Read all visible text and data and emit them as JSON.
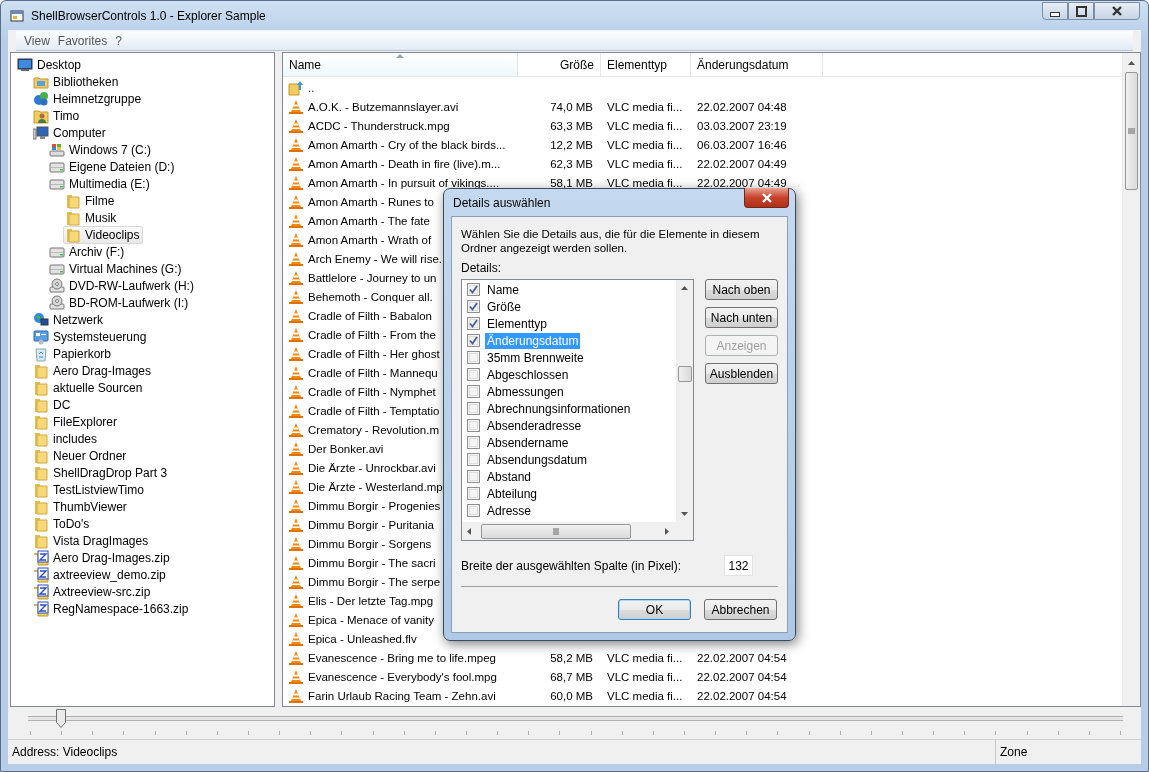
{
  "window": {
    "title": "ShellBrowserControls 1.0 - Explorer Sample"
  },
  "menu": [
    "View",
    "Favorites",
    "?"
  ],
  "tree": {
    "items": [
      {
        "label": "Desktop",
        "kind": "desktop",
        "selected": false,
        "children": [
          {
            "label": "Bibliotheken",
            "kind": "library",
            "selected": false
          },
          {
            "label": "Heimnetzgruppe",
            "kind": "homegroup",
            "selected": false
          },
          {
            "label": "Timo",
            "kind": "user",
            "selected": false
          },
          {
            "label": "Computer",
            "kind": "computer",
            "selected": false,
            "children": [
              {
                "label": "Windows 7 (C:)",
                "kind": "system-drive",
                "selected": false
              },
              {
                "label": "Eigene Dateien (D:)",
                "kind": "drive",
                "selected": false
              },
              {
                "label": "Multimedia (E:)",
                "kind": "drive",
                "selected": false,
                "children": [
                  {
                    "label": "Filme",
                    "kind": "folder",
                    "selected": false
                  },
                  {
                    "label": "Musik",
                    "kind": "folder",
                    "selected": false
                  },
                  {
                    "label": "Videoclips",
                    "kind": "folder",
                    "selected": true
                  }
                ]
              },
              {
                "label": "Archiv (F:)",
                "kind": "drive",
                "selected": false
              },
              {
                "label": "Virtual Machines (G:)",
                "kind": "drive",
                "selected": false
              },
              {
                "label": "DVD-RW-Laufwerk (H:)",
                "kind": "optical",
                "selected": false
              },
              {
                "label": "BD-ROM-Laufwerk (I:)",
                "kind": "optical",
                "selected": false
              }
            ]
          },
          {
            "label": "Netzwerk",
            "kind": "network",
            "selected": false
          },
          {
            "label": "Systemsteuerung",
            "kind": "control-panel",
            "selected": false
          },
          {
            "label": "Papierkorb",
            "kind": "recycle",
            "selected": false
          },
          {
            "label": "Aero Drag-Images",
            "kind": "folder",
            "selected": false
          },
          {
            "label": "aktuelle Sourcen",
            "kind": "folder",
            "selected": false
          },
          {
            "label": "DC",
            "kind": "folder",
            "selected": false
          },
          {
            "label": "FileExplorer",
            "kind": "folder",
            "selected": false
          },
          {
            "label": "includes",
            "kind": "folder",
            "selected": false
          },
          {
            "label": "Neuer Ordner",
            "kind": "folder",
            "selected": false
          },
          {
            "label": "ShellDragDrop Part 3",
            "kind": "folder",
            "selected": false
          },
          {
            "label": "TestListviewTimo",
            "kind": "folder",
            "selected": false
          },
          {
            "label": "ThumbViewer",
            "kind": "folder",
            "selected": false
          },
          {
            "label": "ToDo's",
            "kind": "folder",
            "selected": false
          },
          {
            "label": "Vista DragImages",
            "kind": "folder",
            "selected": false
          },
          {
            "label": "Aero Drag-Images.zip",
            "kind": "zip",
            "selected": false
          },
          {
            "label": "axtreeview_demo.zip",
            "kind": "zip",
            "selected": false
          },
          {
            "label": "Axtreeview-src.zip",
            "kind": "zip",
            "selected": false
          },
          {
            "label": "RegNamespace-1663.zip",
            "kind": "zip",
            "selected": false
          }
        ]
      }
    ]
  },
  "file_list": {
    "columns": [
      {
        "label": "Name",
        "sorted": true
      },
      {
        "label": "Größe",
        "sorted": false
      },
      {
        "label": "Elementtyp",
        "sorted": false
      },
      {
        "label": "Änderungsdatum",
        "sorted": false
      }
    ],
    "rows": [
      {
        "kind": "parent",
        "name": ".."
      },
      {
        "kind": "video",
        "name": "A.O.K. - Butzemannslayer.avi",
        "size": "74,0 MB",
        "type": "VLC media fi...",
        "date": "22.02.2007 04:48"
      },
      {
        "kind": "video",
        "name": "ACDC - Thunderstruck.mpg",
        "size": "63,3 MB",
        "type": "VLC media fi...",
        "date": "03.03.2007 23:19"
      },
      {
        "kind": "video",
        "name": "Amon Amarth - Cry of the black birds...",
        "size": "12,2 MB",
        "type": "VLC media fi...",
        "date": "06.03.2007 16:46"
      },
      {
        "kind": "video",
        "name": "Amon Amarth - Death in fire (live).m...",
        "size": "62,3 MB",
        "type": "VLC media fi...",
        "date": "22.02.2007 04:49"
      },
      {
        "kind": "video",
        "name": "Amon Amarth - In pursuit of vikings....",
        "size": "58,1 MB",
        "type": "VLC media fi...",
        "date": "22.02.2007 04:49"
      },
      {
        "kind": "video",
        "name": "Amon Amarth - Runes to"
      },
      {
        "kind": "video",
        "name": "Amon Amarth - The fate"
      },
      {
        "kind": "video",
        "name": "Amon Amarth - Wrath of"
      },
      {
        "kind": "video",
        "name": "Arch Enemy - We will rise."
      },
      {
        "kind": "video",
        "name": "Battlelore - Journey to un"
      },
      {
        "kind": "video",
        "name": "Behemoth - Conquer all."
      },
      {
        "kind": "video",
        "name": "Cradle of Filth - Babalon"
      },
      {
        "kind": "video",
        "name": "Cradle of Filth - From the"
      },
      {
        "kind": "video",
        "name": "Cradle of Filth - Her ghost"
      },
      {
        "kind": "video",
        "name": "Cradle of Filth - Mannequ"
      },
      {
        "kind": "video",
        "name": "Cradle of Filth - Nymphet"
      },
      {
        "kind": "video",
        "name": "Cradle of Filth - Temptatio"
      },
      {
        "kind": "video",
        "name": "Crematory - Revolution.m"
      },
      {
        "kind": "video",
        "name": "Der Bonker.avi"
      },
      {
        "kind": "video",
        "name": "Die Ärzte - Unrockbar.avi"
      },
      {
        "kind": "video",
        "name": "Die Ärzte - Westerland.mp"
      },
      {
        "kind": "video",
        "name": "Dimmu Borgir - Progenies"
      },
      {
        "kind": "video",
        "name": "Dimmu Borgir - Puritania"
      },
      {
        "kind": "video",
        "name": "Dimmu Borgir - Sorgens"
      },
      {
        "kind": "video",
        "name": "Dimmu Borgir - The sacri"
      },
      {
        "kind": "video",
        "name": "Dimmu Borgir - The serpe"
      },
      {
        "kind": "video",
        "name": "Elis - Der letzte Tag.mpg"
      },
      {
        "kind": "video",
        "name": "Epica - Menace of vanity"
      },
      {
        "kind": "video",
        "name": "Epica - Unleashed.flv"
      },
      {
        "kind": "video",
        "name": "Evanescence - Bring me to life.mpeg",
        "size": "58,2 MB",
        "type": "VLC media fi...",
        "date": "22.02.2007 04:54"
      },
      {
        "kind": "video",
        "name": "Evanescence - Everybody's fool.mpg",
        "size": "68,7 MB",
        "type": "VLC media fi...",
        "date": "22.02.2007 04:54"
      },
      {
        "kind": "video",
        "name": "Farin Urlaub Racing Team - Zehn.avi",
        "size": "60,0 MB",
        "type": "VLC media fi...",
        "date": "22.02.2007 04:54"
      }
    ]
  },
  "dialog": {
    "title": "Details auswählen",
    "description": "Wählen Sie die Details aus, die für die Elemente in diesem Ordner angezeigt werden sollen.",
    "list_label": "Details:",
    "items": [
      {
        "label": "Name",
        "checked": true,
        "selected": false
      },
      {
        "label": "Größe",
        "checked": true,
        "selected": false
      },
      {
        "label": "Elementtyp",
        "checked": true,
        "selected": false
      },
      {
        "label": "Änderungsdatum",
        "checked": true,
        "selected": true
      },
      {
        "label": "35mm Brennweite",
        "checked": false,
        "selected": false
      },
      {
        "label": "Abgeschlossen",
        "checked": false,
        "selected": false
      },
      {
        "label": "Abmessungen",
        "checked": false,
        "selected": false
      },
      {
        "label": "Abrechnungsinformationen",
        "checked": false,
        "selected": false
      },
      {
        "label": "Absenderadresse",
        "checked": false,
        "selected": false
      },
      {
        "label": "Absendername",
        "checked": false,
        "selected": false
      },
      {
        "label": "Absendungsdatum",
        "checked": false,
        "selected": false
      },
      {
        "label": "Abstand",
        "checked": false,
        "selected": false
      },
      {
        "label": "Abteilung",
        "checked": false,
        "selected": false
      },
      {
        "label": "Adresse",
        "checked": false,
        "selected": false
      }
    ],
    "side_buttons": [
      {
        "label": "Nach oben",
        "disabled": false
      },
      {
        "label": "Nach unten",
        "disabled": false
      },
      {
        "label": "Anzeigen",
        "disabled": true
      },
      {
        "label": "Ausblenden",
        "disabled": false
      }
    ],
    "width_label": "Breite der ausgewählten Spalte (in Pixel):",
    "width_value": "132",
    "footer_buttons": [
      {
        "label": "OK",
        "default": true
      },
      {
        "label": "Abbrechen",
        "default": false
      }
    ]
  },
  "slider": {
    "level": 0.03
  },
  "status_bar": {
    "address": "Address: Videoclips",
    "zone": "Zone"
  }
}
